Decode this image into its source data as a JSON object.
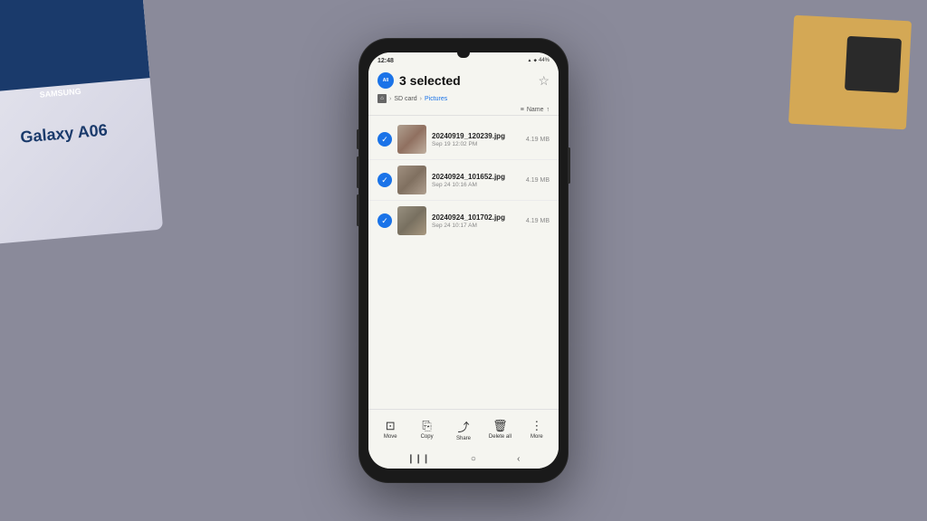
{
  "phone": {
    "status_bar": {
      "time": "12:48",
      "battery": "44%"
    },
    "header": {
      "selected_count": "3 selected",
      "select_all_label": "All"
    },
    "breadcrumb": {
      "home_icon": "⌂",
      "separator": "›",
      "sd_card": "SD card",
      "pictures": "Pictures"
    },
    "sort": {
      "label": "Name",
      "icon": "↑"
    },
    "files": [
      {
        "name": "20240919_120239.jpg",
        "date": "Sep 19 12:02 PM",
        "size": "4.19 MB",
        "checked": true
      },
      {
        "name": "20240924_101652.jpg",
        "date": "Sep 24 10:16 AM",
        "size": "4.19 MB",
        "checked": true
      },
      {
        "name": "20240924_101702.jpg",
        "date": "Sep 24 10:17 AM",
        "size": "4.19 MB",
        "checked": true
      }
    ],
    "toolbar": {
      "items": [
        {
          "icon": "⊡",
          "label": "Move"
        },
        {
          "icon": "⎘",
          "label": "Copy"
        },
        {
          "icon": "⤴",
          "label": "Share"
        },
        {
          "icon": "🗑",
          "label": "Delete all"
        },
        {
          "icon": "⋮",
          "label": "More"
        }
      ]
    },
    "nav": {
      "back": "❙❙❙",
      "home": "○",
      "recent": "‹"
    }
  },
  "bg": {
    "box_brand": "SAMSUNG",
    "box_model": "Galaxy A06"
  }
}
